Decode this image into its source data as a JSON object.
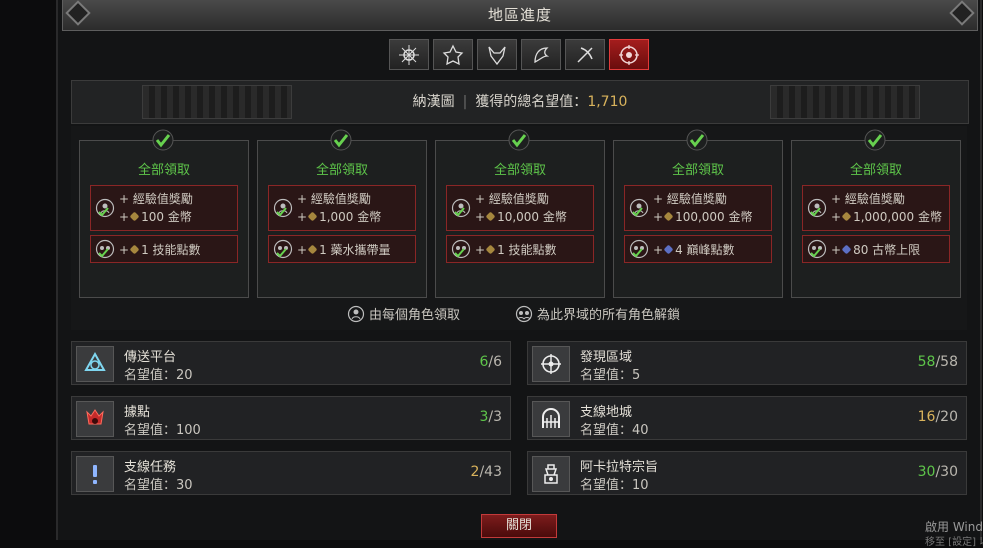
{
  "window": {
    "title": "地區進度"
  },
  "tabs": [
    {
      "icon": "region-1-emblem-icon"
    },
    {
      "icon": "region-2-emblem-icon"
    },
    {
      "icon": "region-3-emblem-icon"
    },
    {
      "icon": "region-4-emblem-icon"
    },
    {
      "icon": "region-5-emblem-icon"
    },
    {
      "icon": "region-6-emblem-icon",
      "active": true
    }
  ],
  "region": {
    "name": "納漢圖",
    "separator": "|",
    "renown_label": "獲得的總名望值：",
    "renown_value": "1,710"
  },
  "tiers": [
    {
      "claim_label": "全部領取",
      "xp": "+ 經驗值獎勵",
      "gold": "100 金幣",
      "bonus": "1 技能點數"
    },
    {
      "claim_label": "全部領取",
      "xp": "+ 經驗值獎勵",
      "gold": "1,000 金幣",
      "bonus": "1 藥水攜帶量"
    },
    {
      "claim_label": "全部領取",
      "xp": "+ 經驗值獎勵",
      "gold": "10,000 金幣",
      "bonus": "1 技能點數"
    },
    {
      "claim_label": "全部領取",
      "xp": "+ 經驗值獎勵",
      "gold": "100,000 金幣",
      "bonus": "4 巔峰點數"
    },
    {
      "claim_label": "全部領取",
      "xp": "+ 經驗值獎勵",
      "gold": "1,000,000 金幣",
      "bonus": "80 古幣上限"
    }
  ],
  "plus": "+",
  "legend": {
    "per_character": "由每個角色領取",
    "account_wide": "為此界域的所有角色解鎖"
  },
  "stats": [
    {
      "name": "傳送平台",
      "renown": "名望值：20",
      "current": "6",
      "total": "/6",
      "status": "done"
    },
    {
      "name": "發現區域",
      "renown": "名望值：5",
      "current": "58",
      "total": "/58",
      "status": "done"
    },
    {
      "name": "據點",
      "renown": "名望值：100",
      "current": "3",
      "total": "/3",
      "status": "done"
    },
    {
      "name": "支線地城",
      "renown": "名望值：40",
      "current": "16",
      "total": "/20",
      "status": "part"
    },
    {
      "name": "支線任務",
      "renown": "名望值：30",
      "current": "2",
      "total": "/43",
      "status": "part"
    },
    {
      "name": "阿卡拉特宗旨",
      "renown": "名望值：10",
      "current": "30",
      "total": "/30",
      "status": "done"
    }
  ],
  "close_button": "關閉",
  "os_overlay": {
    "line1": "啟用 Windo",
    "line2": "移至 [設定] 以"
  },
  "colors": {
    "accent_red": "#a41d1d",
    "complete_green": "#5ec54a",
    "gold": "#d9b35c"
  }
}
